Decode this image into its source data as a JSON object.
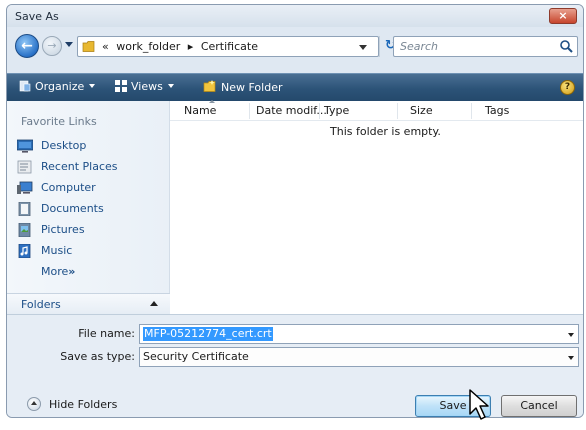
{
  "window": {
    "title": "Save As",
    "close_label": "×"
  },
  "address_bar": {
    "crumbs": [
      "«",
      "work_folder",
      "▸",
      "Certificate"
    ],
    "search_placeholder": "Search"
  },
  "toolbar": {
    "organize_label": "Organize",
    "views_label": "Views",
    "new_folder_label": "New Folder",
    "help_label": "?"
  },
  "navigation": {
    "favorite_links_label": "Favorite Links",
    "items": [
      {
        "label": "Desktop",
        "icon": "desktop-icon"
      },
      {
        "label": "Recent Places",
        "icon": "recent-places-icon"
      },
      {
        "label": "Computer",
        "icon": "computer-icon"
      },
      {
        "label": "Documents",
        "icon": "documents-icon"
      },
      {
        "label": "Pictures",
        "icon": "pictures-icon"
      },
      {
        "label": "Music",
        "icon": "music-icon"
      }
    ],
    "more_label": "More",
    "more_chevron": "»",
    "folders_label": "Folders"
  },
  "file_list": {
    "columns": [
      "Name",
      "Date modif...",
      "Type",
      "Size",
      "Tags"
    ],
    "empty_message": "This folder is empty."
  },
  "form": {
    "file_name_label": "File name:",
    "file_name_value": "MFP-05212774_cert.crt",
    "save_as_type_label": "Save as type:",
    "save_as_type_value": "Security Certificate"
  },
  "footer": {
    "hide_folders_label": "Hide Folders",
    "save_label": "Save",
    "cancel_label": "Cancel"
  },
  "colors": {
    "toolbar": "#2c5378",
    "link": "#1c4e87",
    "selection": "#3399ff",
    "close_button": "#c7452d"
  }
}
